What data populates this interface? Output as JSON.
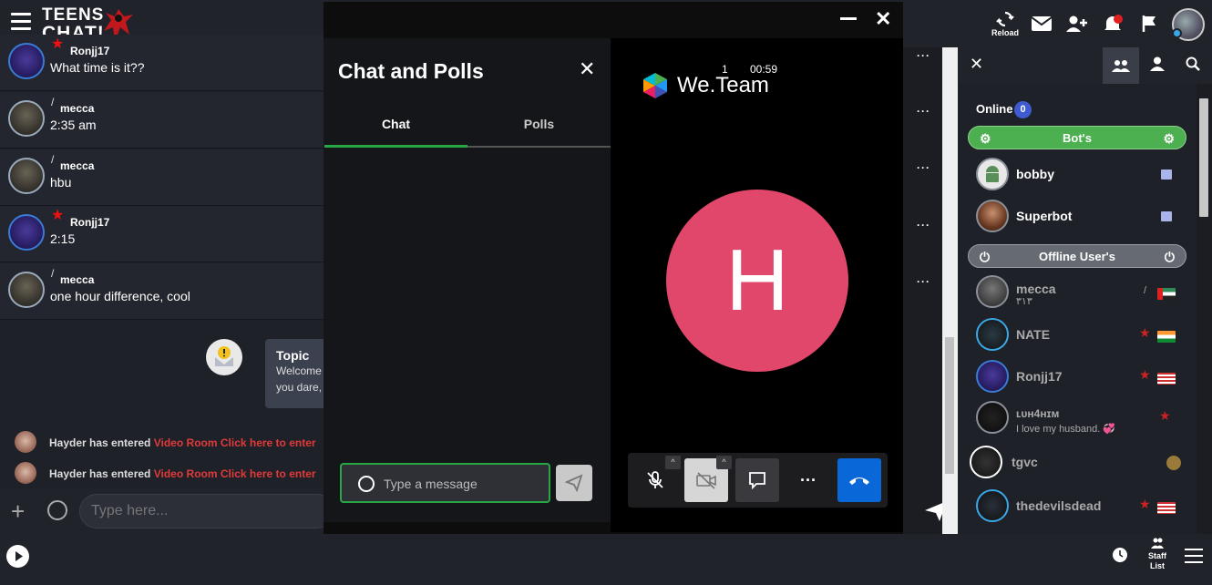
{
  "header": {
    "logo_line1": "TEENS",
    "logo_line2": "CHAT!",
    "reload_label": "Reload",
    "icons": [
      "menu-icon",
      "reload-icon",
      "mail-icon",
      "add-friend-icon",
      "notification-icon",
      "flag-icon",
      "avatar"
    ]
  },
  "messages": [
    {
      "user": "Ronjj17",
      "text": "What time is it??",
      "rank": "star",
      "avatar_style": "blue"
    },
    {
      "user": "mecca",
      "text": "2:35 am",
      "rank": "/",
      "avatar_style": "brown"
    },
    {
      "user": "mecca",
      "text": "hbu",
      "rank": "/",
      "avatar_style": "brown"
    },
    {
      "user": "Ronjj17",
      "text": "2:15",
      "rank": "star",
      "avatar_style": "blue"
    },
    {
      "user": "mecca",
      "text": "one hour difference, cool",
      "rank": "/",
      "avatar_style": "brown"
    }
  ],
  "topic": {
    "heading": "Topic",
    "line1": "Welcome",
    "line2": "you dare,"
  },
  "system_messages": [
    {
      "user": "Hayder",
      "text": "has entered",
      "link": "Video Room Click here to enter"
    },
    {
      "user": "Hayder",
      "text": "has entered",
      "link": "Video Room Click here to enter"
    }
  ],
  "main_input": {
    "placeholder": "Type here..."
  },
  "modal": {
    "panel_title": "Chat and Polls",
    "tabs": [
      "Chat",
      "Polls"
    ],
    "active_tab": "Chat",
    "input_placeholder": "Type a message",
    "brand": "We.Team",
    "participants": "1",
    "timer": "00:59",
    "avatar_letter": "H",
    "avatar_color": "#e1476a",
    "controls": [
      "mic-off-icon",
      "camera-off-icon",
      "chat-icon",
      "more-icon",
      "hangup-icon"
    ]
  },
  "right_panel": {
    "online_label": "Online",
    "online_count": "0",
    "bots_group": "Bot's",
    "offline_group": "Offline User's",
    "bots": [
      {
        "name": "bobby"
      },
      {
        "name": "Superbot"
      }
    ],
    "offline_users": [
      {
        "name": "mecca",
        "sub": "٣١٣",
        "rank": "/",
        "flag": "UAE"
      },
      {
        "name": "NATE",
        "sub": "",
        "rank": "star",
        "flag": "India"
      },
      {
        "name": "Ronjj17",
        "sub": "",
        "rank": "star",
        "flag": "USA"
      },
      {
        "name": "ʟᴜн4ʜɪᴍ",
        "sub": "I love my husband. 💞",
        "rank": "star",
        "flag": ""
      },
      {
        "name": "tgvc",
        "sub": "",
        "rank": "",
        "flag": ""
      },
      {
        "name": "thedevilsdead",
        "sub": "",
        "rank": "star",
        "flag": "USA"
      }
    ]
  },
  "footer": {
    "staff_line1": "Staff",
    "staff_line2": "List"
  },
  "colors": {
    "accent_green": "#27a844",
    "hangup_blue": "#0a67d8",
    "online_badge": "#3f5bd1"
  }
}
